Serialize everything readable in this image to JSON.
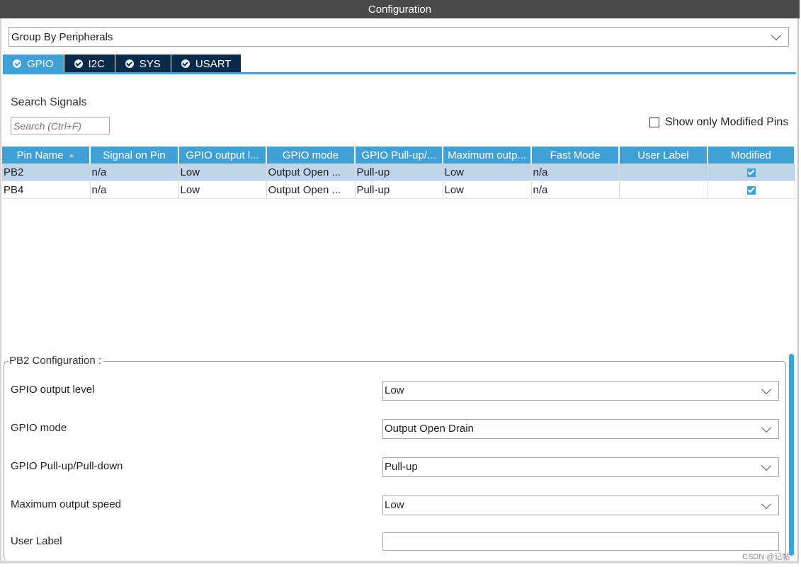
{
  "window": {
    "title": "Configuration"
  },
  "group_select": {
    "value": "Group By Peripherals"
  },
  "tabs": [
    {
      "label": "GPIO",
      "active": true
    },
    {
      "label": "I2C",
      "active": false
    },
    {
      "label": "SYS",
      "active": false
    },
    {
      "label": "USART",
      "active": false
    }
  ],
  "search": {
    "label": "Search Signals",
    "placeholder": "Search (Ctrl+F)"
  },
  "show_modified": {
    "label": "Show only Modified Pins",
    "checked": false
  },
  "table": {
    "columns": [
      "Pin Name",
      "Signal on Pin",
      "GPIO output l...",
      "GPIO mode",
      "GPIO Pull-up/...",
      "Maximum outp...",
      "Fast Mode",
      "User Label",
      "Modified"
    ],
    "rows": [
      {
        "pin": "PB2",
        "signal": "n/a",
        "output_level": "Low",
        "mode": "Output Open ...",
        "pull": "Pull-up",
        "speed": "Low",
        "fast_mode": "n/a",
        "user_label": "",
        "modified": true,
        "selected": true
      },
      {
        "pin": "PB4",
        "signal": "n/a",
        "output_level": "Low",
        "mode": "Output Open ...",
        "pull": "Pull-up",
        "speed": "Low",
        "fast_mode": "n/a",
        "user_label": "",
        "modified": true,
        "selected": false
      }
    ]
  },
  "config": {
    "title": "PB2 Configuration :",
    "fields": {
      "output_level": {
        "label": "GPIO output level",
        "value": "Low"
      },
      "mode": {
        "label": "GPIO mode",
        "value": "Output Open Drain"
      },
      "pull": {
        "label": "GPIO Pull-up/Pull-down",
        "value": "Pull-up"
      },
      "speed": {
        "label": "Maximum output speed",
        "value": "Low"
      },
      "user_label": {
        "label": "User Label",
        "value": ""
      }
    }
  },
  "watermark": "CSDN @记帖",
  "colors": {
    "accent": "#3ea0d5",
    "tab_dark": "#0b2a4a",
    "titlebar": "#4a4a4a",
    "selected_row": "#c0d4ea"
  }
}
